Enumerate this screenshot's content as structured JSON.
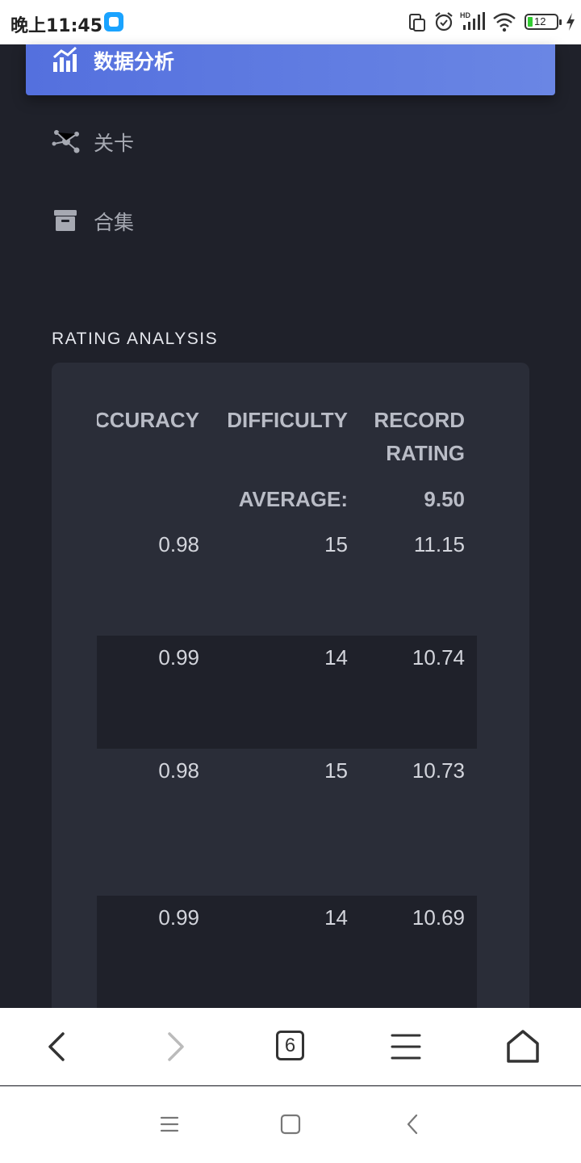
{
  "status_bar": {
    "time": "晚上11:45",
    "battery": "12",
    "icons": [
      "app-notification-icon",
      "screen-rotate-icon",
      "alarm-icon",
      "hd-signal-icon",
      "wifi-icon",
      "battery-icon",
      "charging-icon"
    ]
  },
  "nav": {
    "active_item": {
      "label": "数据分析",
      "icon": "chart-icon"
    },
    "items": [
      {
        "label": "关卡",
        "icon": "nodes-icon"
      },
      {
        "label": "合集",
        "icon": "archive-icon"
      }
    ]
  },
  "section": {
    "title": "RATING ANALYSIS"
  },
  "table": {
    "headers": {
      "accuracy": "CCURACY",
      "difficulty": "DIFFICULTY",
      "record_rating_1": "RECORD",
      "record_rating_2": "RATING"
    },
    "average": {
      "label": "AVERAGE:",
      "value": "9.50"
    },
    "rows": [
      {
        "accuracy": "0.98",
        "difficulty": "15",
        "rating": "11.15"
      },
      {
        "accuracy": "0.99",
        "difficulty": "14",
        "rating": "10.74"
      },
      {
        "accuracy": "0.98",
        "difficulty": "15",
        "rating": "10.73"
      },
      {
        "accuracy": "0.99",
        "difficulty": "14",
        "rating": "10.69"
      }
    ]
  },
  "browser": {
    "tab_count": "6",
    "buttons": [
      "back-icon",
      "forward-icon",
      "tabs-icon",
      "menu-icon",
      "home-icon"
    ]
  },
  "colors": {
    "background": "#1f212a",
    "card": "#2a2d38",
    "accent": "#5470de"
  }
}
